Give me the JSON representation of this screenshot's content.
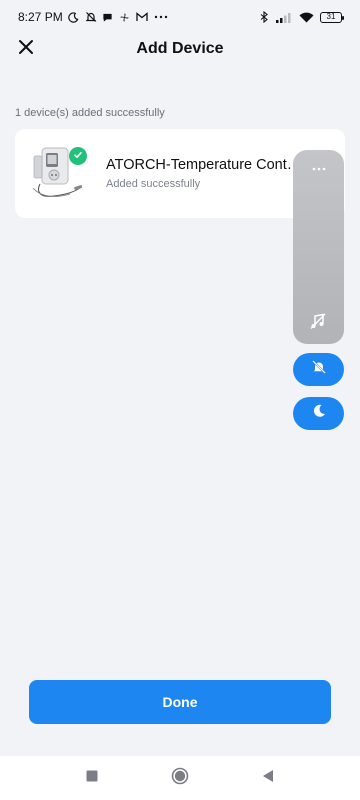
{
  "status_bar": {
    "time": "8:27 PM",
    "battery": "31",
    "icons": [
      "moon-icon",
      "notifications-off-icon",
      "chat-bubble-icon",
      "fan-icon",
      "gmail-icon",
      "more-dots-icon",
      "bluetooth-icon",
      "signal-icon",
      "wifi-icon",
      "battery-icon"
    ]
  },
  "header": {
    "title": "Add Device",
    "close_icon": "close-icon"
  },
  "summary": {
    "text": "1 device(s) added successfully"
  },
  "device": {
    "name": "ATORCH-Temperature Cont…",
    "status": "Added successfully",
    "badge_icon": "check-icon",
    "badge_color": "#22c07a"
  },
  "float_panel": {
    "icons": [
      "more-dots-icon",
      "music-off-icon",
      "bell-off-icon",
      "moon-icon"
    ]
  },
  "footer": {
    "done_label": "Done"
  },
  "nav_bar": {
    "icons": [
      "recent-apps-icon",
      "home-icon",
      "back-icon"
    ]
  },
  "colors": {
    "accent": "#1e86f0",
    "background": "#f2f3f7",
    "success": "#22c07a"
  }
}
